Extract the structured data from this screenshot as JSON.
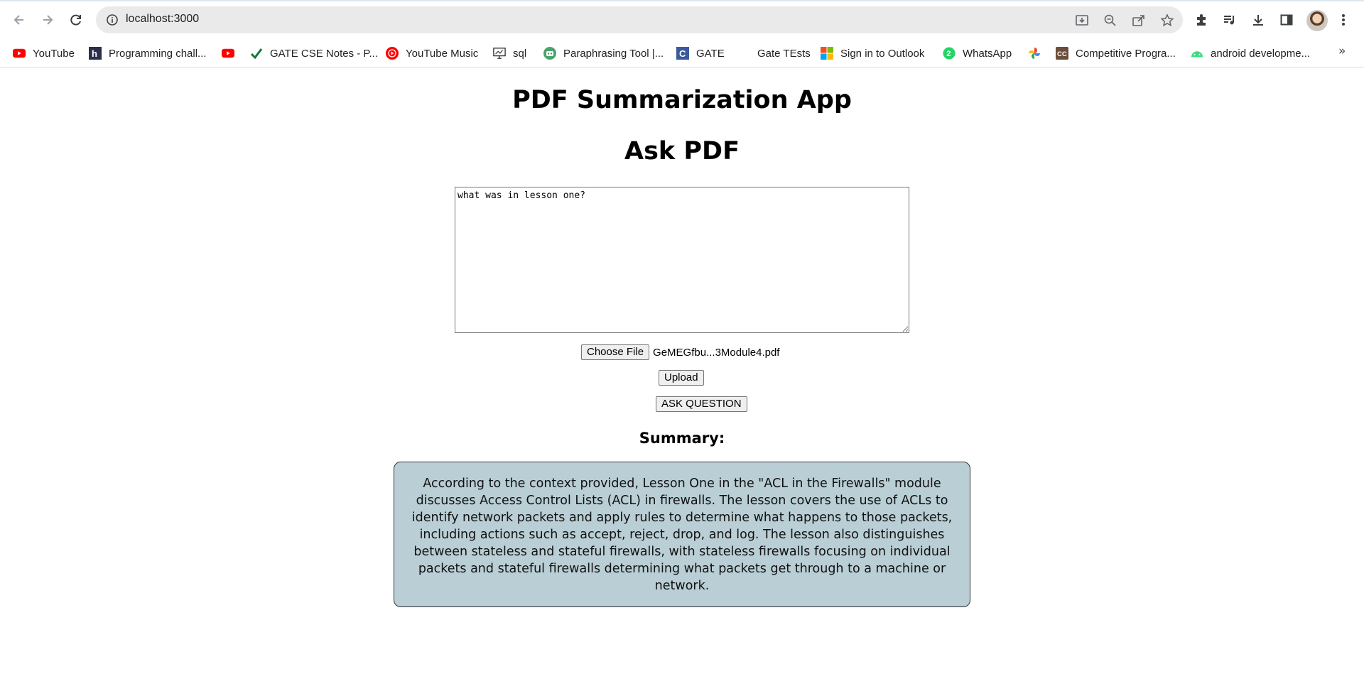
{
  "browser": {
    "url": "localhost:3000",
    "bookmarks": [
      {
        "label": "YouTube",
        "icon": "youtube-icon"
      },
      {
        "label": "Programming chall...",
        "icon": "hackerrank-icon"
      },
      {
        "label": "",
        "icon": "youtube-icon"
      },
      {
        "label": "GATE CSE Notes - P...",
        "icon": "checkmark-icon"
      },
      {
        "label": "YouTube Music",
        "icon": "youtube-music-icon"
      },
      {
        "label": "sql",
        "icon": "monitor-icon"
      },
      {
        "label": "Paraphrasing Tool |...",
        "icon": "robot-icon"
      },
      {
        "label": "GATE",
        "icon": "c-icon"
      },
      {
        "label": "Gate TEsts",
        "icon": ""
      },
      {
        "label": "Sign in to Outlook",
        "icon": "microsoft-icon"
      },
      {
        "label": "WhatsApp",
        "icon": "whatsapp-icon"
      },
      {
        "label": "",
        "icon": "pinwheel-icon"
      },
      {
        "label": "Competitive Progra...",
        "icon": "cc-icon"
      },
      {
        "label": "android developme...",
        "icon": "android-icon"
      }
    ],
    "overflow": "»"
  },
  "app": {
    "title": "PDF Summarization App",
    "ask_title": "Ask PDF",
    "question_value": "what was in lesson one?",
    "choose_file_label": "Choose File",
    "file_name": "GeMEGfbu...3Module4.pdf",
    "upload_label": "Upload",
    "ask_label": "ASK QUESTION",
    "summary_label": "Summary:",
    "summary_text": "According to the context provided, Lesson One in the \"ACL in the Firewalls\" module discusses Access Control Lists (ACL) in firewalls. The lesson covers the use of ACLs to identify network packets and apply rules to determine what happens to those packets, including actions such as accept, reject, drop, and log. The lesson also distinguishes between stateless and stateful firewalls, with stateless firewalls focusing on individual packets and stateful firewalls determining what packets get through to a machine or network."
  },
  "colors": {
    "summary_bg": "#b9ced5",
    "omnibox_bg": "#eaeaea"
  }
}
